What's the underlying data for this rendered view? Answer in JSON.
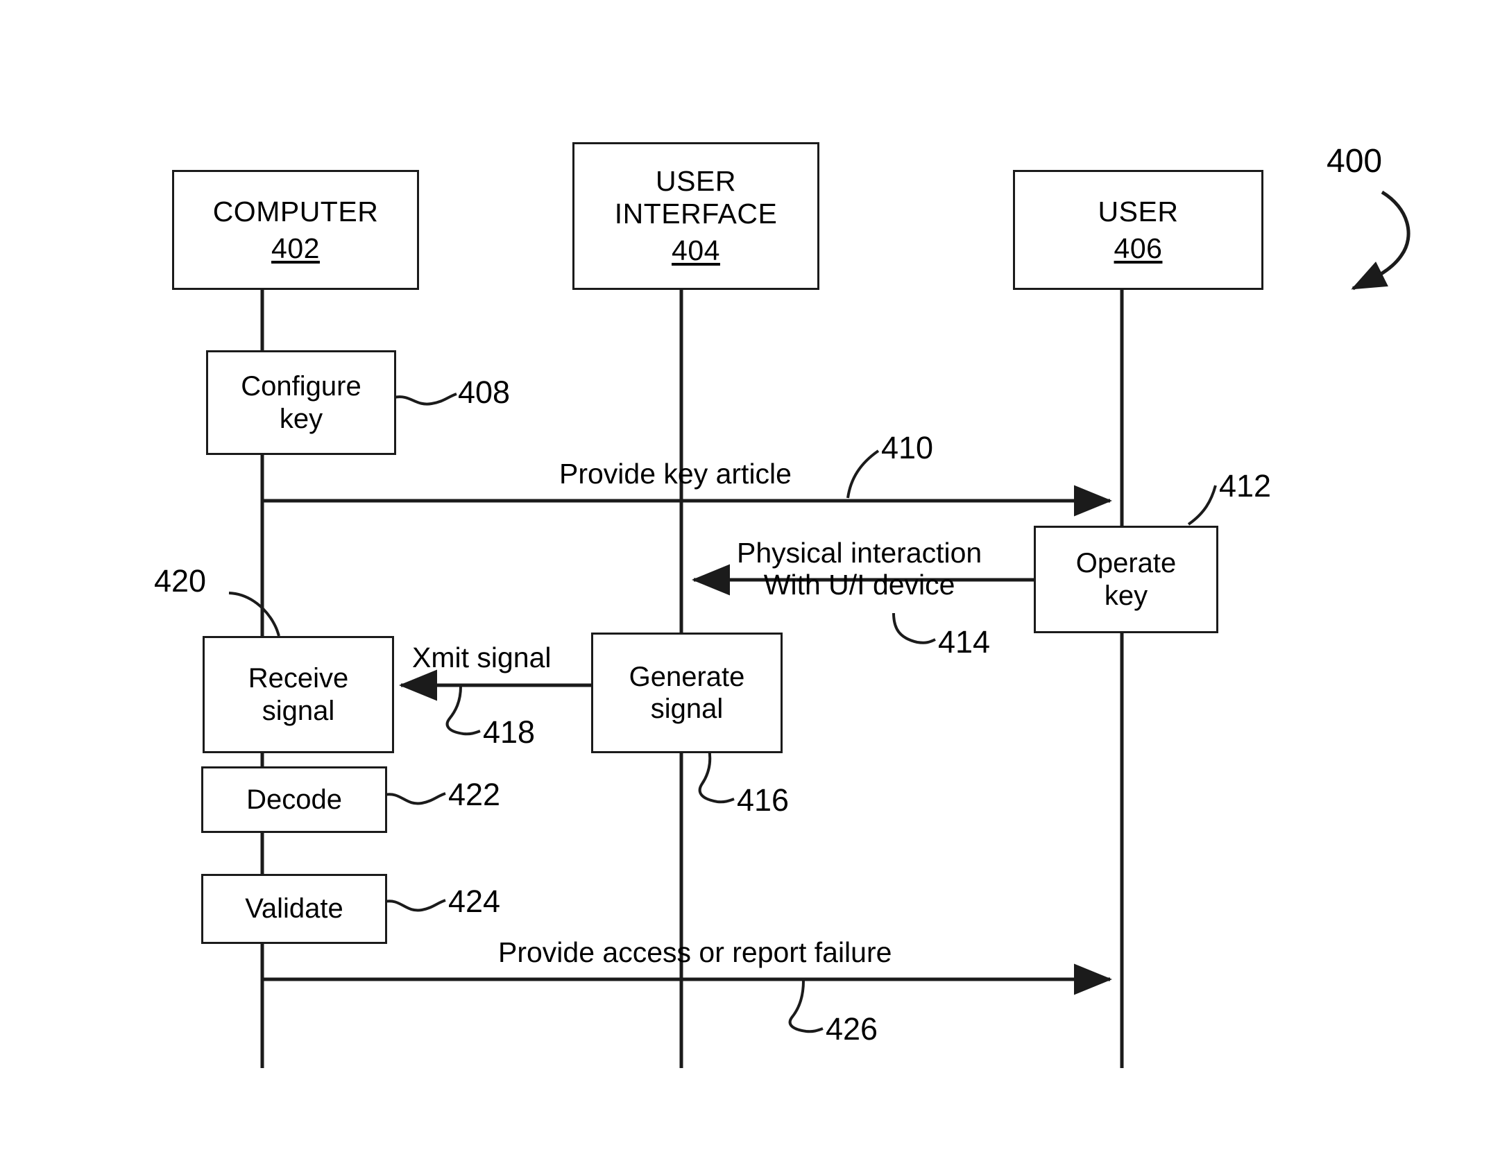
{
  "figure": {
    "number": "400",
    "type": "sequence-diagram"
  },
  "participants": [
    {
      "id": "computer",
      "title": "COMPUTER",
      "title2": "",
      "ref": "402"
    },
    {
      "id": "ui",
      "title": "USER",
      "title2": "INTERFACE",
      "ref": "404"
    },
    {
      "id": "user",
      "title": "USER",
      "title2": "",
      "ref": "406"
    }
  ],
  "activities": [
    {
      "id": "configure",
      "line1": "Configure",
      "line2": "key",
      "ref": "408",
      "lane": "computer"
    },
    {
      "id": "operate",
      "line1": "Operate",
      "line2": "key",
      "ref": "412",
      "lane": "user"
    },
    {
      "id": "receive",
      "line1": "Receive",
      "line2": "signal",
      "ref": "420",
      "lane": "computer"
    },
    {
      "id": "generate",
      "line1": "Generate",
      "line2": "signal",
      "ref": "416",
      "lane": "ui"
    },
    {
      "id": "decode",
      "line1": "Decode",
      "line2": "",
      "ref": "422",
      "lane": "computer"
    },
    {
      "id": "validate",
      "line1": "Validate",
      "line2": "",
      "ref": "424",
      "lane": "computer"
    }
  ],
  "messages": [
    {
      "id": "provide-key-article",
      "line1": "Provide key article",
      "line2": "",
      "ref": "410",
      "from": "computer",
      "to": "user"
    },
    {
      "id": "physical-interaction",
      "line1": "Physical interaction",
      "line2": "With U/I device",
      "ref": "414",
      "from": "user",
      "to": "ui"
    },
    {
      "id": "xmit-signal",
      "line1": "Xmit signal",
      "line2": "",
      "ref": "418",
      "from": "ui",
      "to": "computer"
    },
    {
      "id": "provide-access",
      "line1": "Provide access or report failure",
      "line2": "",
      "ref": "426",
      "from": "computer",
      "to": "user"
    }
  ],
  "colors": {
    "ink": "#1b1b1b",
    "background": "#ffffff"
  }
}
